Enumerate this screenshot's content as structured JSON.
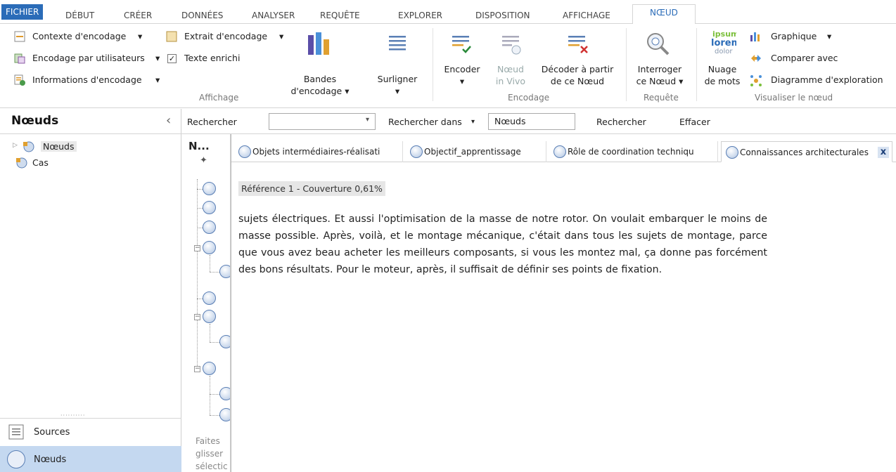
{
  "menu": {
    "tabs": [
      "FICHIER",
      "DÉBUT",
      "CRÉER",
      "DONNÉES",
      "ANALYSER",
      "REQUÊTE",
      "EXPLORER",
      "DISPOSITION",
      "AFFICHAGE",
      "NŒUD"
    ],
    "active_tab": "NŒUD"
  },
  "ribbon": {
    "affichage": {
      "contexte": "Contexte d'encodage",
      "encodage_users": "Encodage par utilisateurs",
      "informations": "Informations d'encodage",
      "extrait": "Extrait d'encodage",
      "texte_enrichi": "Texte enrichi",
      "texte_enrichi_checked": "✓",
      "bandes_line1": "Bandes",
      "bandes_line2": "d'encodage ▾",
      "surligner": "Surligner",
      "group_label": "Affichage"
    },
    "encodage": {
      "encoder": "Encoder",
      "noeud_line1": "Nœud",
      "noeud_line2": "in Vivo",
      "decoder_line1": "Décoder à partir",
      "decoder_line2": "de ce Nœud",
      "group_label": "Encodage"
    },
    "requete": {
      "interroger_line1": "Interroger",
      "interroger_line2": "ce Nœud ▾",
      "group_label": "Requête"
    },
    "visualiser": {
      "nuage_line1": "Nuage",
      "nuage_line2": "de mots",
      "graphique": "Graphique",
      "comparer": "Comparer avec",
      "diagramme": "Diagramme d'exploration",
      "group_label": "Visualiser le nœud",
      "wordcloud_words": [
        "ipsum",
        "lorem",
        "dolor"
      ]
    }
  },
  "left_panel": {
    "title": "Nœuds",
    "tree": [
      "Nœuds",
      "Cas"
    ],
    "nav": [
      "Sources",
      "Nœuds"
    ]
  },
  "search": {
    "rechercher_label": "Rechercher",
    "rechercher_dans": "Rechercher dans",
    "scope_value": "Nœuds",
    "rechercher_button": "Rechercher",
    "effacer_button": "Effacer"
  },
  "mid_column": {
    "title": "N...",
    "hint_lines": [
      "Faites",
      "glisser",
      "sélectic"
    ]
  },
  "doc": {
    "tabs": [
      "Objets intermédiaires-réalisati",
      "Objectif_apprentissage",
      "Rôle de coordination techniqu",
      "Connaissances architecturales"
    ],
    "close_label": "x",
    "reference": "Référence 1 - Couverture 0,61%",
    "text": "sujets électriques. Et aussi l'optimisation de la masse de notre rotor. On voulait embarquer le moins de masse possible. Après, voilà, et le montage mécanique, c'était dans tous les sujets de montage, parce que vous avez beau acheter les meilleurs composants, si vous les montez mal, ça donne pas forcément des bons résultats. Pour le moteur, après, il suffisait de définir ses points de fixation."
  },
  "colors": {
    "accent": "#2b6cb8",
    "nav_active": "#c4d8f0",
    "node_circle": "#aebfdc"
  }
}
